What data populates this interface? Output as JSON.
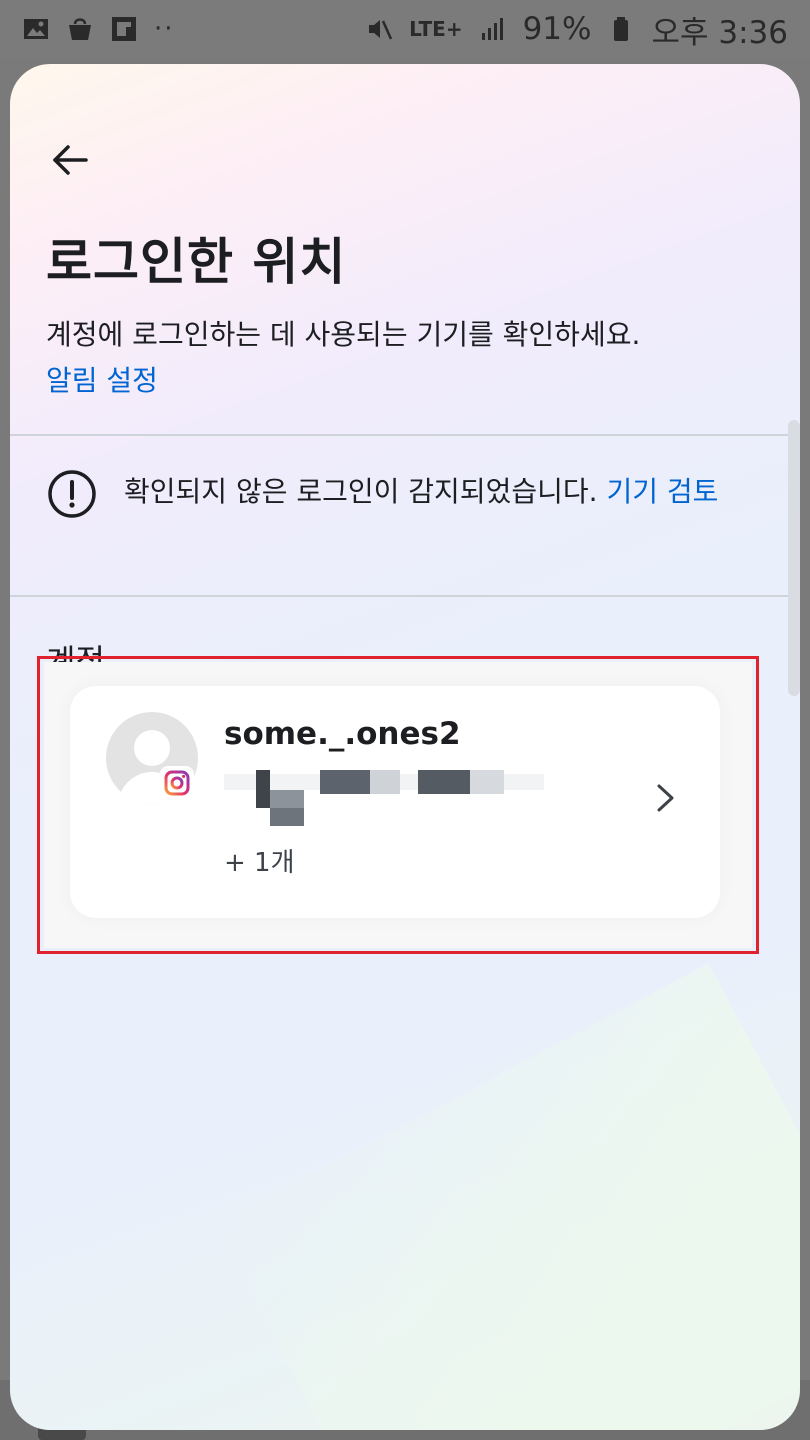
{
  "status_bar": {
    "battery": "91%",
    "time": "오후 3:36",
    "network": "LTE+",
    "icons": [
      "gallery-icon",
      "shopping-bag-icon",
      "flipboard-icon",
      "more-dots-icon",
      "mute-icon",
      "signal-icon",
      "battery-icon"
    ]
  },
  "header": {
    "title": "로그인한 위치",
    "description": "계정에 로그인하는 데 사용되는 기기를 확인하세요.",
    "settings_link": "알림 설정"
  },
  "alert": {
    "text": "확인되지 않은 로그인이 감지되었습니다. ",
    "link": "기기 검토"
  },
  "section": {
    "title": "계정"
  },
  "account_card": {
    "username": "some._.ones2",
    "more_count": "+ 1개",
    "platform_icon": "instagram-icon"
  },
  "colors": {
    "link": "#0064d1",
    "highlight_border": "#e0212e",
    "text": "#1c1e21"
  }
}
